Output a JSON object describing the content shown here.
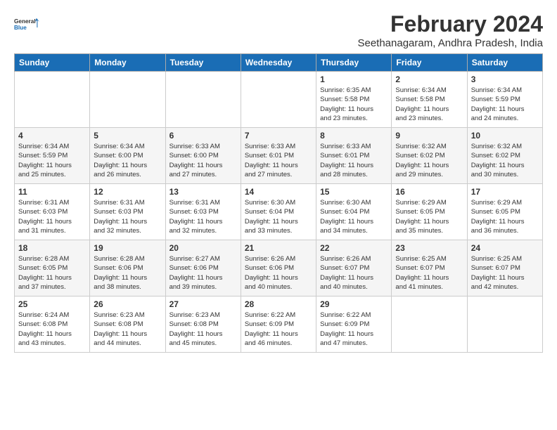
{
  "logo": {
    "line1": "General",
    "line2": "Blue"
  },
  "title": "February 2024",
  "subtitle": "Seethanagaram, Andhra Pradesh, India",
  "days_of_week": [
    "Sunday",
    "Monday",
    "Tuesday",
    "Wednesday",
    "Thursday",
    "Friday",
    "Saturday"
  ],
  "weeks": [
    [
      {
        "day": "",
        "info": ""
      },
      {
        "day": "",
        "info": ""
      },
      {
        "day": "",
        "info": ""
      },
      {
        "day": "",
        "info": ""
      },
      {
        "day": "1",
        "info": "Sunrise: 6:35 AM\nSunset: 5:58 PM\nDaylight: 11 hours\nand 23 minutes."
      },
      {
        "day": "2",
        "info": "Sunrise: 6:34 AM\nSunset: 5:58 PM\nDaylight: 11 hours\nand 23 minutes."
      },
      {
        "day": "3",
        "info": "Sunrise: 6:34 AM\nSunset: 5:59 PM\nDaylight: 11 hours\nand 24 minutes."
      }
    ],
    [
      {
        "day": "4",
        "info": "Sunrise: 6:34 AM\nSunset: 5:59 PM\nDaylight: 11 hours\nand 25 minutes."
      },
      {
        "day": "5",
        "info": "Sunrise: 6:34 AM\nSunset: 6:00 PM\nDaylight: 11 hours\nand 26 minutes."
      },
      {
        "day": "6",
        "info": "Sunrise: 6:33 AM\nSunset: 6:00 PM\nDaylight: 11 hours\nand 27 minutes."
      },
      {
        "day": "7",
        "info": "Sunrise: 6:33 AM\nSunset: 6:01 PM\nDaylight: 11 hours\nand 27 minutes."
      },
      {
        "day": "8",
        "info": "Sunrise: 6:33 AM\nSunset: 6:01 PM\nDaylight: 11 hours\nand 28 minutes."
      },
      {
        "day": "9",
        "info": "Sunrise: 6:32 AM\nSunset: 6:02 PM\nDaylight: 11 hours\nand 29 minutes."
      },
      {
        "day": "10",
        "info": "Sunrise: 6:32 AM\nSunset: 6:02 PM\nDaylight: 11 hours\nand 30 minutes."
      }
    ],
    [
      {
        "day": "11",
        "info": "Sunrise: 6:31 AM\nSunset: 6:03 PM\nDaylight: 11 hours\nand 31 minutes."
      },
      {
        "day": "12",
        "info": "Sunrise: 6:31 AM\nSunset: 6:03 PM\nDaylight: 11 hours\nand 32 minutes."
      },
      {
        "day": "13",
        "info": "Sunrise: 6:31 AM\nSunset: 6:03 PM\nDaylight: 11 hours\nand 32 minutes."
      },
      {
        "day": "14",
        "info": "Sunrise: 6:30 AM\nSunset: 6:04 PM\nDaylight: 11 hours\nand 33 minutes."
      },
      {
        "day": "15",
        "info": "Sunrise: 6:30 AM\nSunset: 6:04 PM\nDaylight: 11 hours\nand 34 minutes."
      },
      {
        "day": "16",
        "info": "Sunrise: 6:29 AM\nSunset: 6:05 PM\nDaylight: 11 hours\nand 35 minutes."
      },
      {
        "day": "17",
        "info": "Sunrise: 6:29 AM\nSunset: 6:05 PM\nDaylight: 11 hours\nand 36 minutes."
      }
    ],
    [
      {
        "day": "18",
        "info": "Sunrise: 6:28 AM\nSunset: 6:05 PM\nDaylight: 11 hours\nand 37 minutes."
      },
      {
        "day": "19",
        "info": "Sunrise: 6:28 AM\nSunset: 6:06 PM\nDaylight: 11 hours\nand 38 minutes."
      },
      {
        "day": "20",
        "info": "Sunrise: 6:27 AM\nSunset: 6:06 PM\nDaylight: 11 hours\nand 39 minutes."
      },
      {
        "day": "21",
        "info": "Sunrise: 6:26 AM\nSunset: 6:06 PM\nDaylight: 11 hours\nand 40 minutes."
      },
      {
        "day": "22",
        "info": "Sunrise: 6:26 AM\nSunset: 6:07 PM\nDaylight: 11 hours\nand 40 minutes."
      },
      {
        "day": "23",
        "info": "Sunrise: 6:25 AM\nSunset: 6:07 PM\nDaylight: 11 hours\nand 41 minutes."
      },
      {
        "day": "24",
        "info": "Sunrise: 6:25 AM\nSunset: 6:07 PM\nDaylight: 11 hours\nand 42 minutes."
      }
    ],
    [
      {
        "day": "25",
        "info": "Sunrise: 6:24 AM\nSunset: 6:08 PM\nDaylight: 11 hours\nand 43 minutes."
      },
      {
        "day": "26",
        "info": "Sunrise: 6:23 AM\nSunset: 6:08 PM\nDaylight: 11 hours\nand 44 minutes."
      },
      {
        "day": "27",
        "info": "Sunrise: 6:23 AM\nSunset: 6:08 PM\nDaylight: 11 hours\nand 45 minutes."
      },
      {
        "day": "28",
        "info": "Sunrise: 6:22 AM\nSunset: 6:09 PM\nDaylight: 11 hours\nand 46 minutes."
      },
      {
        "day": "29",
        "info": "Sunrise: 6:22 AM\nSunset: 6:09 PM\nDaylight: 11 hours\nand 47 minutes."
      },
      {
        "day": "",
        "info": ""
      },
      {
        "day": "",
        "info": ""
      }
    ]
  ]
}
